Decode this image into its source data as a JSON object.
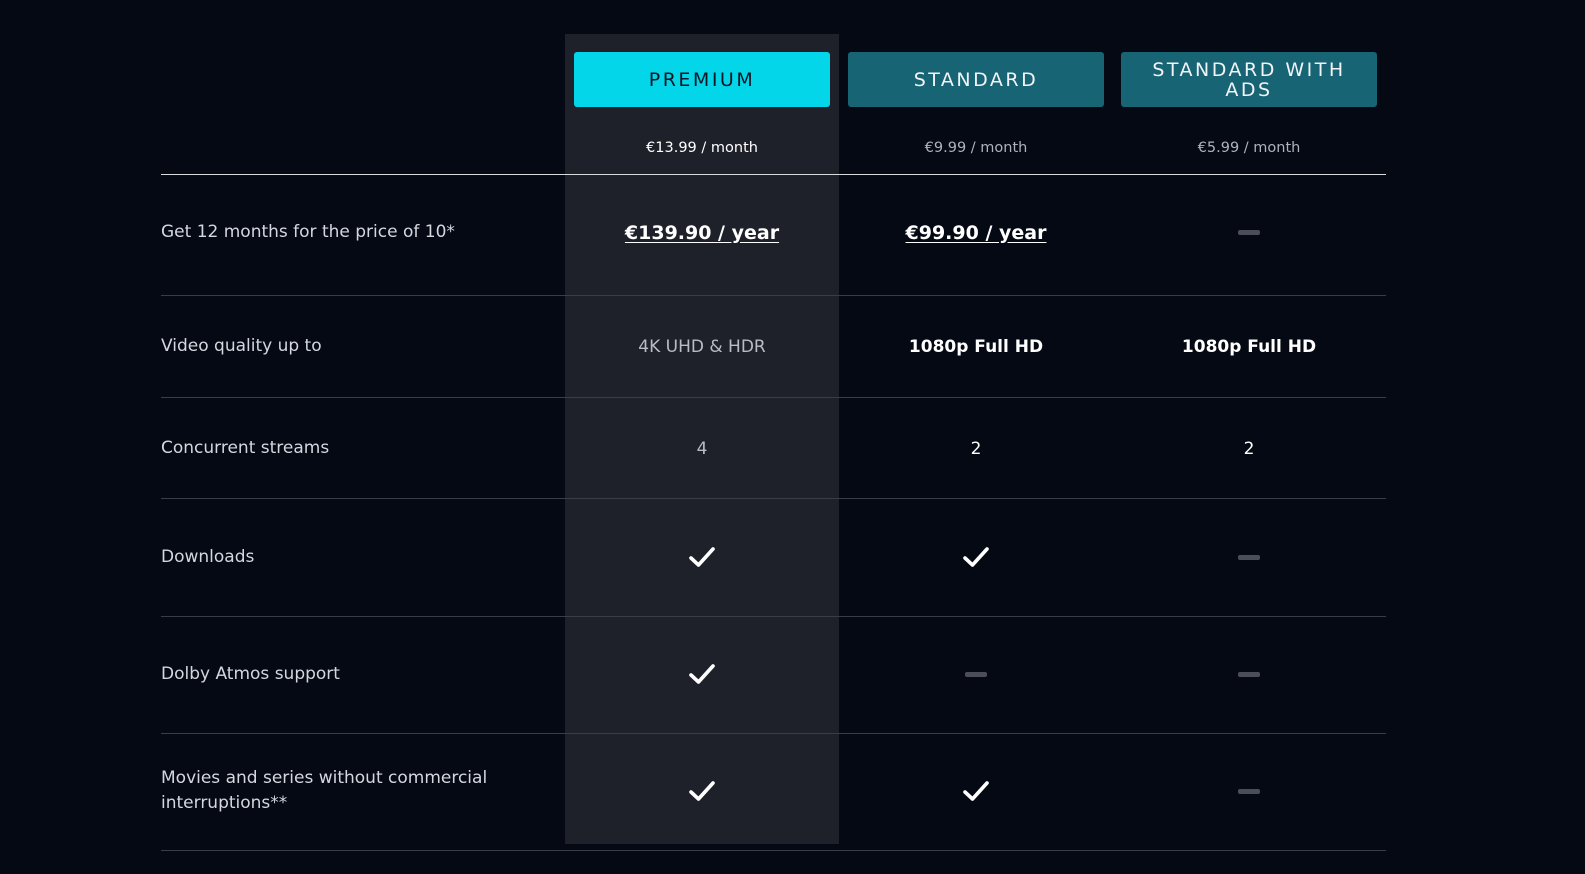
{
  "plans": [
    {
      "name": "PREMIUM",
      "price": "€13.99 / month"
    },
    {
      "name": "STANDARD",
      "price": "€9.99 / month"
    },
    {
      "name": "STANDARD WITH ADS",
      "price": "€5.99 / month"
    }
  ],
  "rows": [
    {
      "label": "Get 12 months for the price of 10*",
      "values": [
        "€139.90 / year",
        "€99.90 / year",
        "none"
      ]
    },
    {
      "label": "Video quality up to",
      "values": [
        "4K UHD & HDR",
        "1080p Full HD",
        "1080p Full HD"
      ]
    },
    {
      "label": "Concurrent streams",
      "values": [
        "4",
        "2",
        "2"
      ]
    },
    {
      "label": "Downloads",
      "values": [
        "check",
        "check",
        "none"
      ]
    },
    {
      "label": "Dolby Atmos support",
      "values": [
        "check",
        "none",
        "none"
      ]
    },
    {
      "label": "Movies and series without commercial interruptions**",
      "values": [
        "check",
        "check",
        "none"
      ]
    }
  ],
  "colors": {
    "background": "#050913",
    "premium_button": "#03d6e8",
    "standard_button": "#166474",
    "highlight_column": "#1f212a"
  }
}
